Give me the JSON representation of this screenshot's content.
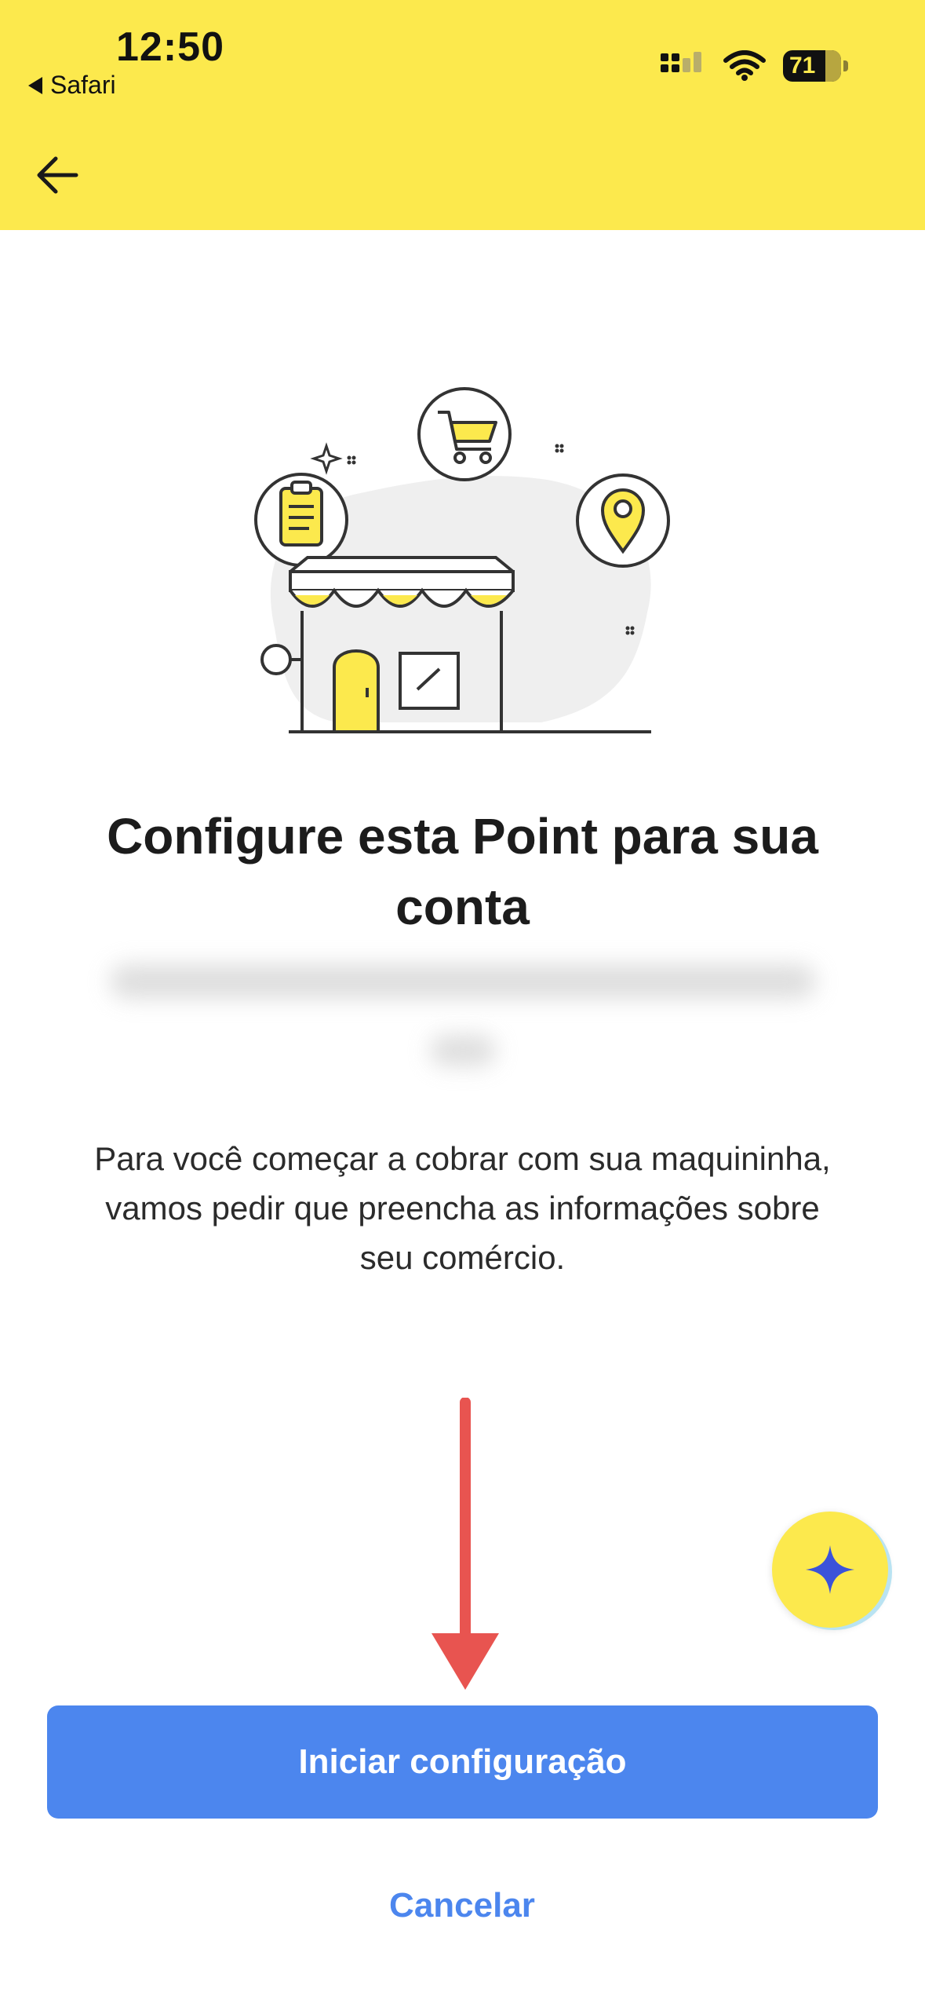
{
  "status_bar": {
    "time": "12:50",
    "back_app_label": "Safari",
    "battery": "71"
  },
  "page": {
    "title": "Configure esta Point para sua conta",
    "description": "Para você começar a cobrar com sua maquininha, vamos pedir que preencha as informações sobre seu comércio."
  },
  "actions": {
    "primary_label": "Iniciar configuração",
    "cancel_label": "Cancelar"
  },
  "colors": {
    "header_bg": "#fce94d",
    "primary": "#4c86ee",
    "arrow": "#e85450"
  },
  "icons": [
    "back-arrow-icon",
    "cellular-signal-icon",
    "wifi-icon",
    "battery-icon",
    "store-illustration",
    "sparkle-icon"
  ]
}
